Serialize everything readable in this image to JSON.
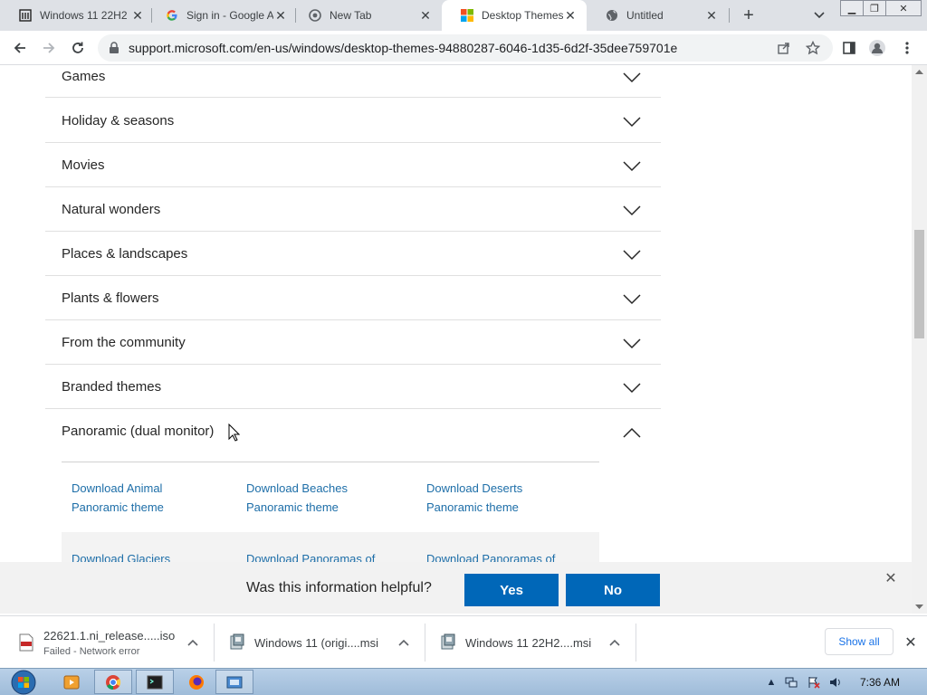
{
  "browser": {
    "tabs": [
      {
        "title": "Windows 11 22H2",
        "favicon": "archive-icon"
      },
      {
        "title": "Sign in - Google A",
        "favicon": "google-icon"
      },
      {
        "title": "New Tab",
        "favicon": "chrome-icon"
      },
      {
        "title": "Desktop Themes",
        "favicon": "microsoft-icon",
        "active": true
      },
      {
        "title": "Untitled",
        "favicon": "globe-icon"
      }
    ],
    "url": "support.microsoft.com/en-us/windows/desktop-themes-94880287-6046-1d35-6d2f-35dee759701e"
  },
  "accordion": [
    {
      "label": "Games",
      "expanded": false
    },
    {
      "label": "Holiday & seasons",
      "expanded": false
    },
    {
      "label": "Movies",
      "expanded": false
    },
    {
      "label": "Natural wonders",
      "expanded": false
    },
    {
      "label": "Places & landscapes",
      "expanded": false
    },
    {
      "label": "Plants & flowers",
      "expanded": false
    },
    {
      "label": "From the community",
      "expanded": false
    },
    {
      "label": "Branded themes",
      "expanded": false
    },
    {
      "label": "Panoramic (dual monitor)",
      "expanded": true
    }
  ],
  "panoramic_links": [
    {
      "line1": "Download Animal",
      "line2": "Panoramic theme"
    },
    {
      "line1": "Download Beaches",
      "line2": "Panoramic theme"
    },
    {
      "line1": "Download Deserts",
      "line2": "Panoramic theme"
    },
    {
      "line1": "Download Glaciers",
      "line2": ""
    },
    {
      "line1": "Download Panoramas of",
      "line2": ""
    },
    {
      "line1": "Download Panoramas of",
      "line2": ""
    }
  ],
  "feedback": {
    "question": "Was this information helpful?",
    "yes_label": "Yes",
    "no_label": "No"
  },
  "downloads": [
    {
      "name": "22621.1.ni_release.....iso",
      "status": "Failed - Network error"
    },
    {
      "name": "Windows 11 (origi....msi",
      "status": ""
    },
    {
      "name": "Windows 11 22H2....msi",
      "status": ""
    }
  ],
  "download_bar": {
    "show_all_label": "Show all"
  },
  "taskbar": {
    "clock": "7:36 AM"
  },
  "colors": {
    "link": "#1d6ea8",
    "feedback_button": "#0067b8"
  }
}
